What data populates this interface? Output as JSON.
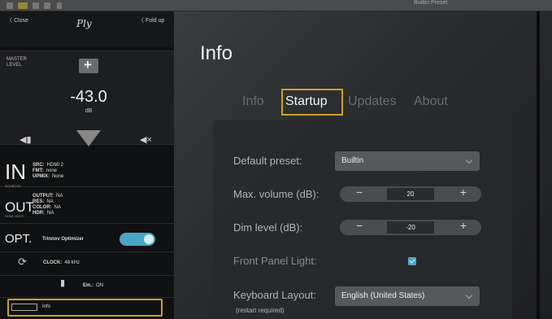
{
  "topbar": {
    "preset_hint": "Builtin Preset"
  },
  "left": {
    "close": "Close",
    "brand": "Ply",
    "foldup": "Fold up",
    "master_level": "MASTER LEVEL",
    "volume": "-43.0",
    "volume_unit": "dB",
    "in": {
      "big": "IN",
      "tag": "SOURCES",
      "src_k": "SRC:",
      "src_v": "HDMI 2",
      "fmt_k": "FMT:",
      "fmt_v": "none",
      "upmix_k": "UPMIX:",
      "upmix_v": "None"
    },
    "out": {
      "big": "OUT",
      "tag": "HDMI VIDEO",
      "output_k": "OUTPUT:",
      "output_v": "NA",
      "res_k": "RES:",
      "res_v": "NA",
      "color_k": "COLOR:",
      "color_v": "NA",
      "hdr_k": "HDR:",
      "hdr_v": "NA"
    },
    "opt": {
      "big": "OPT.",
      "label": "Trinnov Optimizer"
    },
    "clock": {
      "k": "CLOCK:",
      "v": "48 kHz"
    },
    "em": {
      "k": "Em.:",
      "v": "ON"
    },
    "info": "Info"
  },
  "main": {
    "title": "Info",
    "tabs": [
      "Info",
      "Startup",
      "Updates",
      "About"
    ],
    "default_preset": {
      "label": "Default preset:",
      "value": "Builtin"
    },
    "max_volume": {
      "label": "Max. volume (dB):",
      "value": "20",
      "minus": "−",
      "plus": "+"
    },
    "dim_level": {
      "label": "Dim level (dB):",
      "value": "-20",
      "minus": "−",
      "plus": "+"
    },
    "front_panel": {
      "label": "Front Panel Light:"
    },
    "keyboard": {
      "label": "Keyboard Layout:",
      "value": "English (United States)",
      "note": "(restart required)"
    }
  }
}
